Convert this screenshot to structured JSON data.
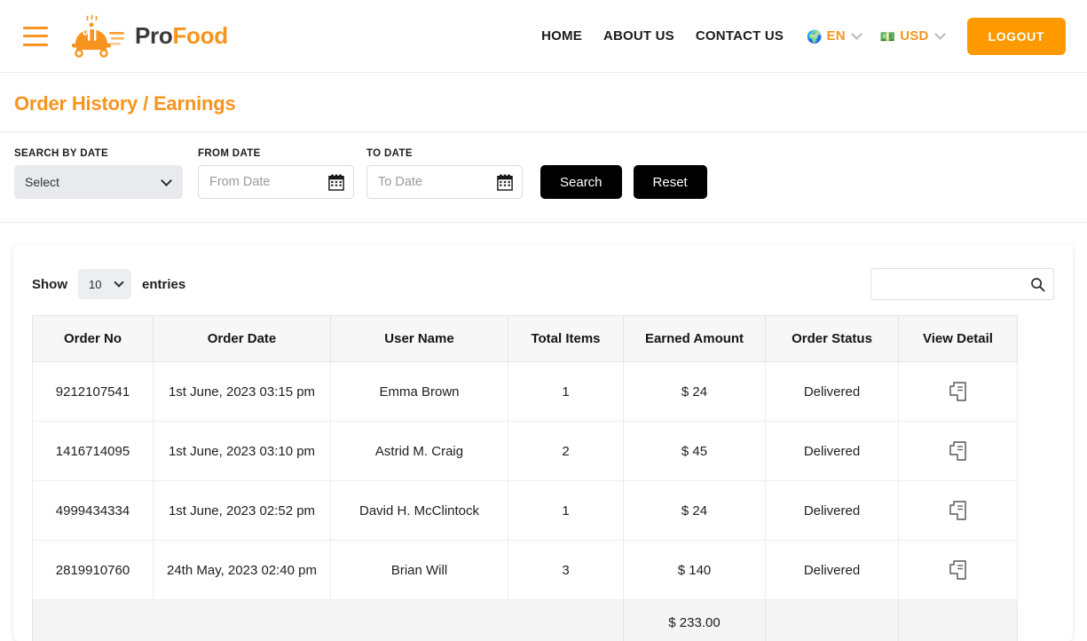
{
  "brand": {
    "name_part1": "Pro",
    "name_part2": "Food",
    "logo_icon": "food-cloche-delivery-icon"
  },
  "topnav": {
    "menu_icon": "hamburger-menu-icon",
    "links": [
      {
        "label": "HOME",
        "name": "nav-link-home"
      },
      {
        "label": "ABOUT US",
        "name": "nav-link-about-us"
      },
      {
        "label": "CONTACT US",
        "name": "nav-link-contact-us"
      }
    ],
    "language": {
      "icon": "globe-icon",
      "glyph": "🌍",
      "label": "EN"
    },
    "currency": {
      "icon": "money-icon",
      "glyph": "💵",
      "label": "USD"
    },
    "logout_label": "LOGOUT"
  },
  "page": {
    "title": "Order History / Earnings"
  },
  "filters": {
    "search_by_date": {
      "label": "SEARCH BY DATE",
      "value": "Select"
    },
    "from_date": {
      "label": "FROM DATE",
      "value": "",
      "placeholder": "From  Date",
      "icon": "calendar-icon"
    },
    "to_date": {
      "label": "TO DATE",
      "value": "",
      "placeholder": "To Date",
      "icon": "calendar-icon"
    },
    "search_button": "Search",
    "reset_button": "Reset"
  },
  "table_controls": {
    "show_label": "Show",
    "page_length": "10",
    "entries_label": "entries",
    "search_value": "",
    "search_placeholder": "",
    "search_icon": "search-icon"
  },
  "table": {
    "columns": [
      "Order No",
      "Order Date",
      "User Name",
      "Total Items",
      "Earned Amount",
      "Order Status",
      "View Detail"
    ],
    "rows": [
      {
        "order_no": "9212107541",
        "order_date": "1st June, 2023 03:15 pm",
        "user_name": "Emma Brown",
        "total_items": "1",
        "earned_amount": "$ 24",
        "order_status": "Delivered",
        "view_detail_icon": "receipt-icon"
      },
      {
        "order_no": "1416714095",
        "order_date": "1st June, 2023 03:10 pm",
        "user_name": "Astrid M. Craig",
        "total_items": "2",
        "earned_amount": "$ 45",
        "order_status": "Delivered",
        "view_detail_icon": "receipt-icon"
      },
      {
        "order_no": "4999434334",
        "order_date": "1st June, 2023 02:52 pm",
        "user_name": "David H. McClintock",
        "total_items": "1",
        "earned_amount": "$ 24",
        "order_status": "Delivered",
        "view_detail_icon": "receipt-icon"
      },
      {
        "order_no": "2819910760",
        "order_date": "24th May, 2023 02:40 pm",
        "user_name": "Brian Will",
        "total_items": "3",
        "earned_amount": "$ 140",
        "order_status": "Delivered",
        "view_detail_icon": "receipt-icon"
      }
    ],
    "total_label": "",
    "total_amount": "$ 233.00"
  },
  "colors": {
    "brand_orange": "#f7941e",
    "button_orange": "#fe9900",
    "dark_button": "#000000",
    "header_bg": "#f7f7f8"
  }
}
